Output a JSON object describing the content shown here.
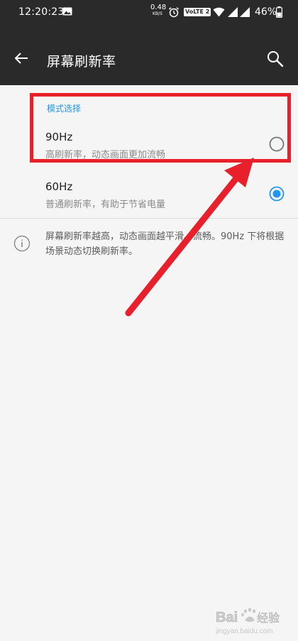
{
  "status_bar": {
    "time": "12:20:23",
    "net_speed_value": "0.48",
    "net_speed_unit": "KB/S",
    "volte": "VoLTE 2",
    "battery": "46%",
    "icons": [
      "image-icon",
      "alarm-icon",
      "wifi-icon",
      "signal-icon",
      "signal-icon",
      "battery-icon"
    ]
  },
  "app_bar": {
    "title": "屏幕刷新率",
    "back_icon": "arrow-back-icon",
    "search_icon": "search-icon"
  },
  "section": {
    "header": "模式选择"
  },
  "options": [
    {
      "title": "90Hz",
      "subtitle": "高刷新率，动态画面更加流畅",
      "selected": false
    },
    {
      "title": "60Hz",
      "subtitle": "普通刷新率，有助于节省电量",
      "selected": true
    }
  ],
  "info": {
    "icon": "info-icon",
    "text": "屏幕刷新率越高，动态画面越平滑、流畅。90Hz 下将根据场景动态切换刷新率。"
  },
  "annotation": {
    "color": "#e8202c",
    "highlight_target": "90Hz"
  },
  "watermark": {
    "brand": "Bai",
    "brand_suffix": "经验",
    "url": "jingyan.baidu.com"
  },
  "colors": {
    "header_bg": "#2a2a2a",
    "accent": "#2196f3",
    "background": "#f5f5f5",
    "annotation_red": "#e8202c"
  }
}
